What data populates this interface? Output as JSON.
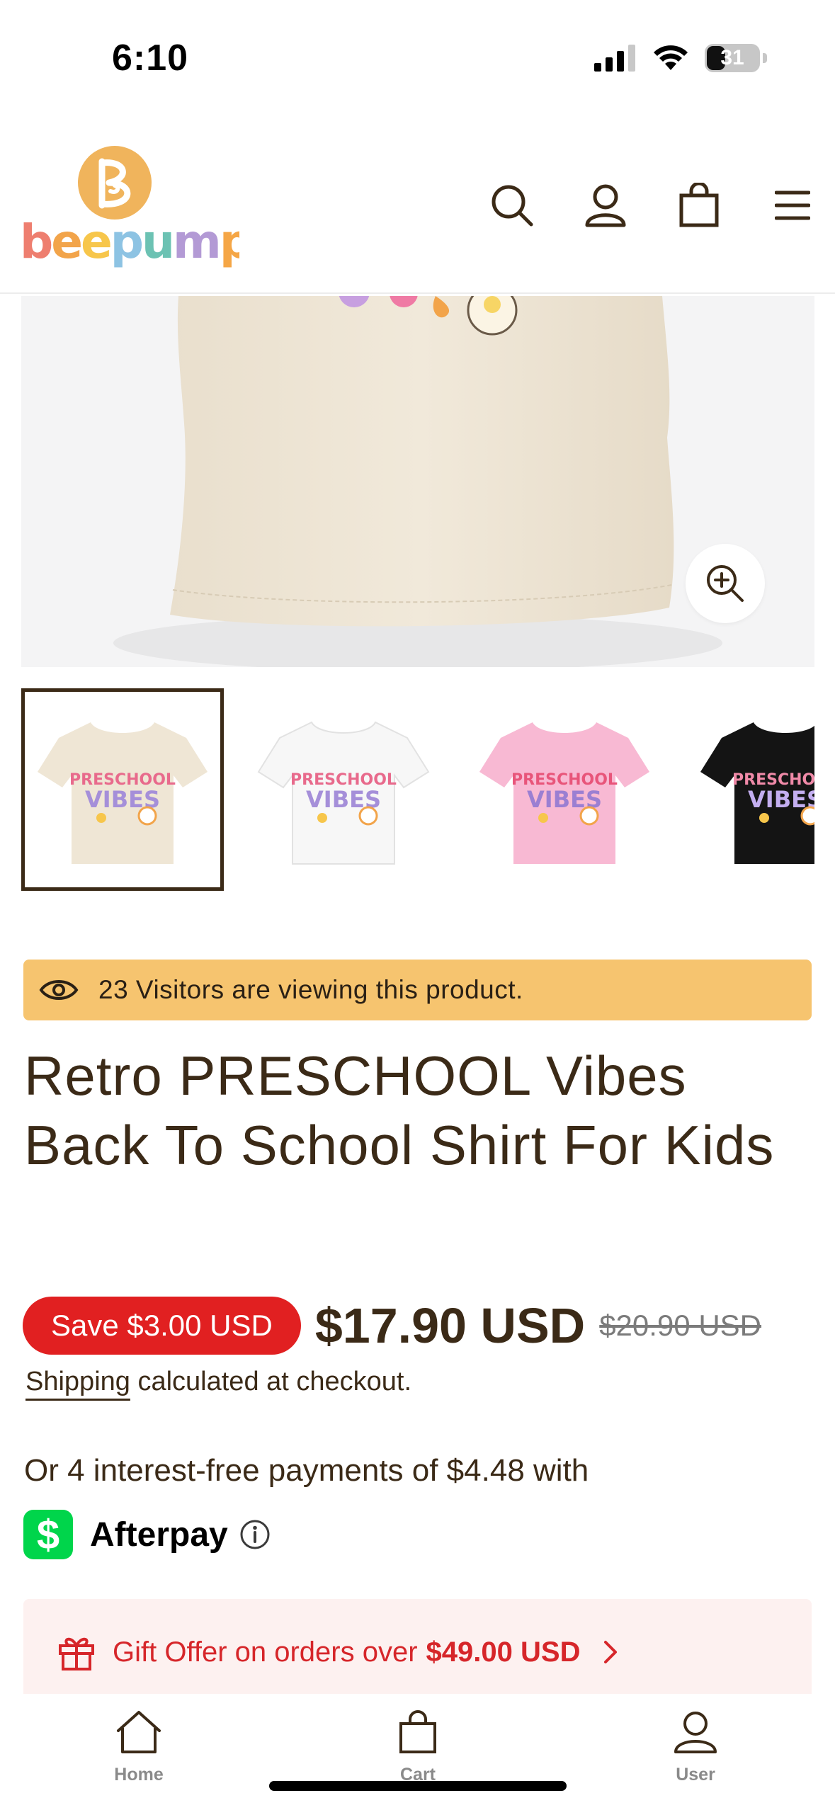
{
  "status_bar": {
    "time": "6:10",
    "battery": "31",
    "icons": [
      "signal-icon",
      "wifi-icon",
      "battery-icon"
    ]
  },
  "header": {
    "logo_text": "beepumpkin",
    "icons": [
      "search-icon",
      "user-icon",
      "bag-icon",
      "menu-icon"
    ]
  },
  "gallery": {
    "zoom_icon": "zoom-in-icon",
    "thumbnails": [
      {
        "color": "cream",
        "print_line1": "PRESCHOOL",
        "print_line2": "VIBES",
        "selected": true
      },
      {
        "color": "white",
        "print_line1": "PRESCHOOL",
        "print_line2": "VIBES",
        "selected": false
      },
      {
        "color": "pink",
        "print_line1": "PRESCHOOL",
        "print_line2": "VIBES",
        "selected": false
      },
      {
        "color": "black",
        "print_line1": "PRESCHOOL",
        "print_line2": "VIBES",
        "selected": false
      }
    ]
  },
  "visitors": {
    "text": "23 Visitors are viewing this product."
  },
  "product": {
    "title": "Retro PRESCHOOL Vibes Back To School Shirt For Kids",
    "save_label": "Save $3.00 USD",
    "price": "$17.90 USD",
    "compare_price": "$20.90 USD",
    "shipping_link": "Shipping",
    "shipping_text": " calculated at checkout."
  },
  "afterpay": {
    "line": "Or 4 interest-free payments of $4.48 with",
    "cashapp_symbol": "$",
    "brand": "Afterpay"
  },
  "gift": {
    "text": "Gift Offer on orders over",
    "amount": "$49.00 USD"
  },
  "bottom_nav": {
    "items": [
      {
        "label": "Home",
        "icon": "home-icon"
      },
      {
        "label": "Cart",
        "icon": "bag-icon"
      },
      {
        "label": "User",
        "icon": "user-icon"
      }
    ]
  },
  "colors": {
    "brand_text": "#3b2a17",
    "visitor_banner": "#f6c46f",
    "sale_red": "#e12021",
    "gift_bg": "#fdf1f0",
    "cashapp_green": "#00d54b"
  }
}
